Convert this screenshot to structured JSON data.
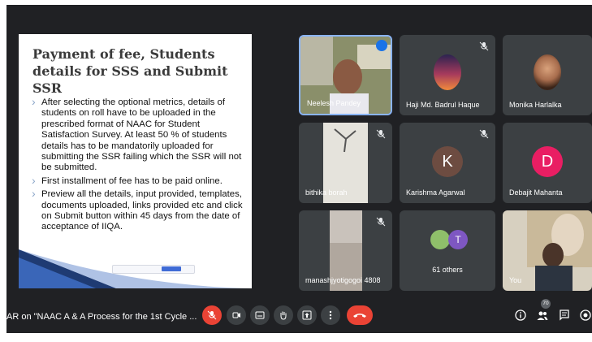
{
  "slide": {
    "title": "Payment of fee, Students details for SSS and Submit SSR",
    "bullets": [
      "After selecting the optional metrics, details of students on roll have to be uploaded in the prescribed format of NAAC for Student Satisfaction Survey. At least 50 % of students details has to be mandatorily uploaded for submitting the SSR failing which the SSR will not be submitted.",
      "First installment of fee has to be paid online.",
      "Preview all the details, input provided, templates, documents uploaded, links provided etc and click on Submit button within 45 days from the date of acceptance of IIQA."
    ]
  },
  "participants": [
    {
      "name": "Neelesh Pandey",
      "speaking": true
    },
    {
      "name": "Haji Md. Badrul Haque",
      "muted": true
    },
    {
      "name": "Monika Harlalka",
      "muted": true
    },
    {
      "name": "bithika borah",
      "muted": true
    },
    {
      "name": "Karishma Agarwal",
      "muted": true,
      "initial": "K",
      "color": "#6d4c41"
    },
    {
      "name": "Debajit Mahanta",
      "muted": true,
      "initial": "D",
      "color": "#e91e63"
    },
    {
      "name": "manashjyotigogoi 4808",
      "muted": true
    },
    {
      "name": "61 others",
      "initial": "T",
      "color": "#7e57c2"
    },
    {
      "name": "You"
    }
  ],
  "meeting": {
    "title": "AR on \"NAAC A & A Process for the 1st Cycle ...",
    "participant_count": "70"
  },
  "controls": [
    "mic-off",
    "camera",
    "captions",
    "raise-hand",
    "present",
    "more",
    "end-call"
  ],
  "right_controls": [
    "info",
    "people",
    "chat",
    "activities"
  ],
  "colors": {
    "background": "#202124",
    "tile": "#3c4043",
    "end_call": "#ea4335",
    "speaking": "#1a73e8"
  }
}
